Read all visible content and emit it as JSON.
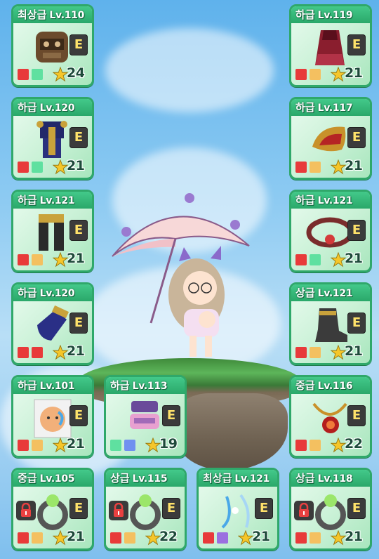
{
  "colors": {
    "card_border": "#2fa86a",
    "card_header": "#2aa86a",
    "red": "#e83a3a",
    "mint": "#5fe0a0",
    "orange": "#f4c060",
    "blue": "#7090f0",
    "purple": "#9b70e0",
    "star": "#f5c62a"
  },
  "equip_badge": "E",
  "items": [
    {
      "grade": "최상급",
      "level": "Lv.110",
      "stars": "24",
      "opts": [
        "red",
        "mint"
      ],
      "locked": false,
      "icon": "helmet-icon"
    },
    {
      "grade": "하급",
      "level": "Lv.119",
      "stars": "21",
      "opts": [
        "red",
        "orange"
      ],
      "locked": false,
      "icon": "cape-icon"
    },
    {
      "grade": "하급",
      "level": "Lv.120",
      "stars": "21",
      "opts": [
        "red",
        "mint"
      ],
      "locked": false,
      "icon": "overall-armor-icon"
    },
    {
      "grade": "하급",
      "level": "Lv.117",
      "stars": "21",
      "opts": [
        "red",
        "orange"
      ],
      "locked": false,
      "icon": "shoulder-icon"
    },
    {
      "grade": "하급",
      "level": "Lv.121",
      "stars": "21",
      "opts": [
        "red",
        "orange"
      ],
      "locked": false,
      "icon": "pants-icon"
    },
    {
      "grade": "하급",
      "level": "Lv.121",
      "stars": "21",
      "opts": [
        "red",
        "mint"
      ],
      "locked": false,
      "icon": "belt-icon"
    },
    {
      "grade": "하급",
      "level": "Lv.120",
      "stars": "21",
      "opts": [
        "red",
        "red"
      ],
      "locked": false,
      "icon": "gloves-icon"
    },
    {
      "grade": "상급",
      "level": "Lv.121",
      "stars": "21",
      "opts": [
        "red",
        "orange"
      ],
      "locked": false,
      "icon": "shoes-icon"
    },
    {
      "grade": "하급",
      "level": "Lv.101",
      "stars": "21",
      "opts": [
        "red",
        "orange"
      ],
      "locked": false,
      "icon": "face-accessory-icon"
    },
    {
      "grade": "하급",
      "level": "Lv.113",
      "stars": "19",
      "opts": [
        "mint",
        "blue"
      ],
      "locked": false,
      "icon": "eye-accessory-icon"
    },
    {
      "grade": "중급",
      "level": "Lv.116",
      "stars": "22",
      "opts": [
        "red",
        "orange"
      ],
      "locked": false,
      "icon": "pendant-icon"
    },
    {
      "grade": "중급",
      "level": "Lv.105",
      "stars": "21",
      "opts": [
        "red",
        "orange"
      ],
      "locked": true,
      "icon": "ring-icon"
    },
    {
      "grade": "상급",
      "level": "Lv.115",
      "stars": "22",
      "opts": [
        "red",
        "orange"
      ],
      "locked": true,
      "icon": "ring-icon"
    },
    {
      "grade": "최상급",
      "level": "Lv.121",
      "stars": "21",
      "opts": [
        "red",
        "purple"
      ],
      "locked": false,
      "icon": "earring-icon"
    },
    {
      "grade": "상급",
      "level": "Lv.118",
      "stars": "21",
      "opts": [
        "red",
        "orange"
      ],
      "locked": true,
      "icon": "ring-icon"
    }
  ]
}
